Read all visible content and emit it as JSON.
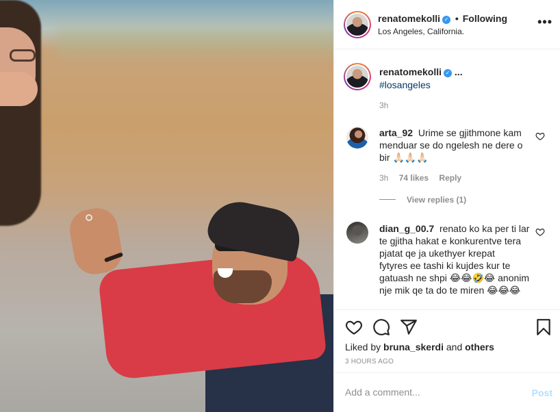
{
  "header": {
    "username": "renatomekolli",
    "verified_glyph": "✓",
    "separator": "•",
    "follow_status": "Following",
    "location": "Los Angeles, California.",
    "more_glyph": "•••"
  },
  "caption": {
    "username": "renatomekolli",
    "truncated": "...",
    "hashtag": "#losangeles",
    "time": "3h"
  },
  "comments": [
    {
      "username": "arta_92",
      "text": "Urime se gjithmone kam",
      "text2": "menduar se do ngelesh ne dere o",
      "text3": "bir 🙏🏻🙏🏻🙏🏻",
      "time": "3h",
      "likes": "74 likes",
      "reply": "Reply",
      "view_replies": "View replies (1)"
    },
    {
      "username": "dian_g_00.7",
      "line1": "renato ko ka per ti lar",
      "line2": "te gjitha hakat e konkurentve tera",
      "line3": "pjatat qe ja ukethyer krepat",
      "line4": "fytyres ee tashi ki kujdes kur te",
      "line5": "gatuash ne shpi 😂😂🤣😂 anonim",
      "line6": "nje mik qe ta do te miren 😂😂😂"
    }
  ],
  "actions": {
    "liked_by_prefix": "Liked by",
    "liked_by_user": "bruna_skerdi",
    "liked_by_and": "and",
    "liked_by_others": "others",
    "time_ago": "3 HOURS AGO"
  },
  "comment_box": {
    "placeholder": "Add a comment...",
    "post_label": "Post"
  },
  "icons": {
    "like": "heart-icon",
    "comment": "comment-icon",
    "share": "share-icon",
    "save": "bookmark-icon"
  },
  "colors": {
    "link": "#00376b",
    "verified": "#3897f0",
    "muted": "#8e8e8e",
    "post_disabled": "#b2dffc"
  }
}
